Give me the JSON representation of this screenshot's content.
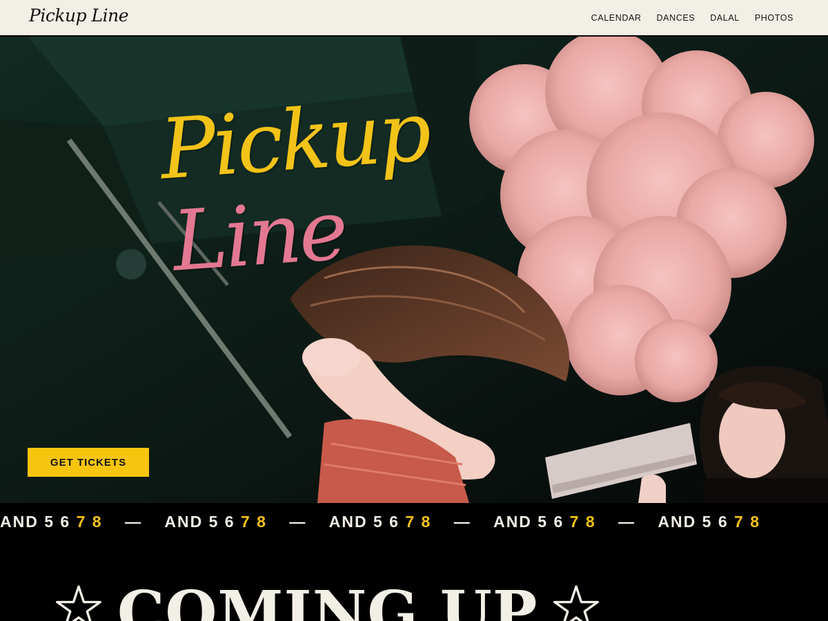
{
  "header": {
    "logo": "Pickup Line",
    "nav": [
      "CALENDAR",
      "DANCES",
      "DALAL",
      "PHOTOS"
    ]
  },
  "hero": {
    "wordmark_line1": "Pickup",
    "wordmark_line2": "Line",
    "cta_label": "GET TICKETS"
  },
  "ticker": {
    "lead": "AND 5 6",
    "accent": "7 8",
    "separator": "—",
    "items": [
      {
        "lead": "AND 5 6",
        "accent": "7 8"
      },
      {
        "lead": "AND 5 6",
        "accent": "7 8"
      },
      {
        "lead": "AND 5 6",
        "accent": "7 8"
      },
      {
        "lead": "AND 5 6",
        "accent": "7 8"
      },
      {
        "lead": "AND 5 6",
        "accent": "7 8"
      }
    ]
  },
  "section": {
    "title": "COMING UP"
  },
  "colors": {
    "header_bg": "#f2efe7",
    "accent_yellow": "#f7c50e",
    "accent_pink": "#e37892",
    "background": "#000000"
  }
}
